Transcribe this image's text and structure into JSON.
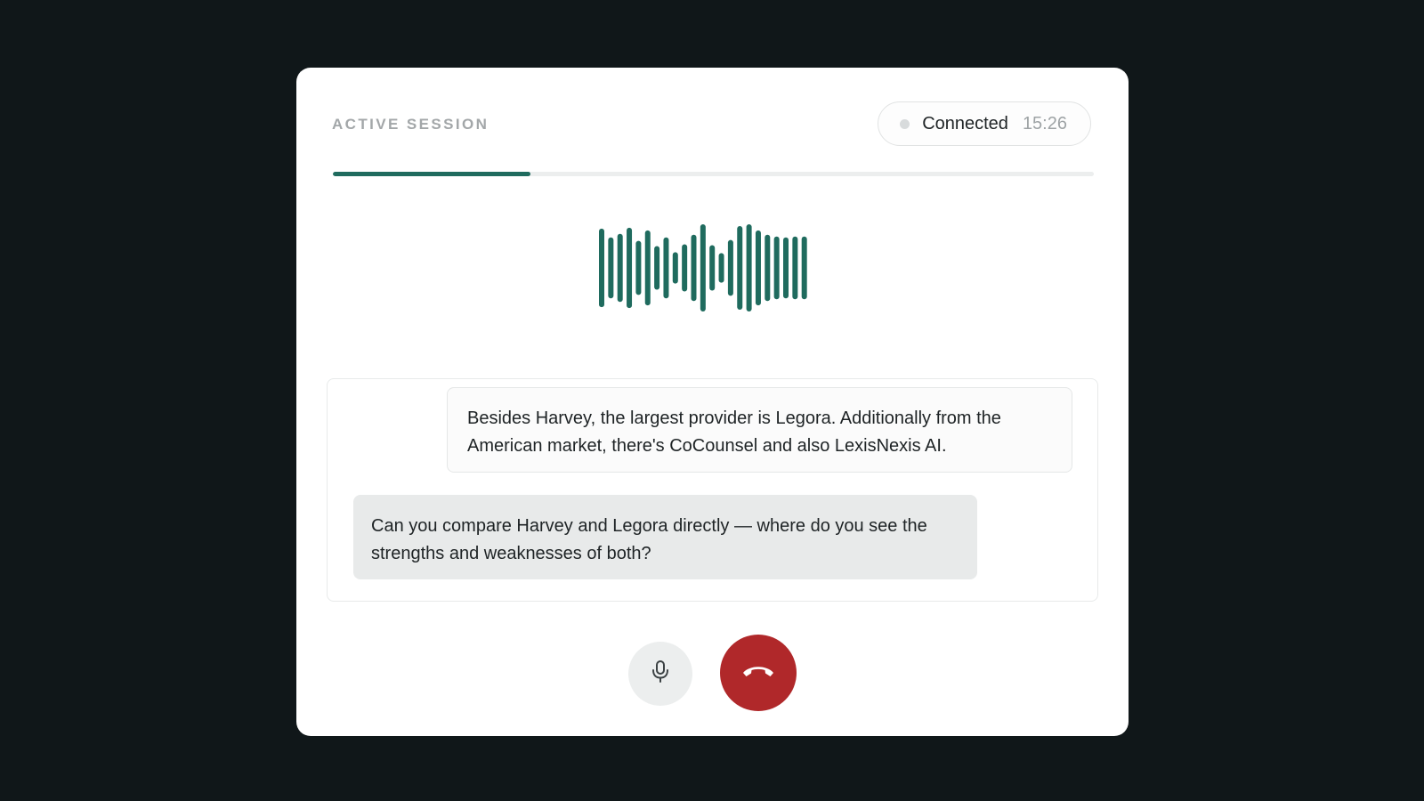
{
  "session": {
    "label": "ACTIVE SESSION",
    "status": "Connected",
    "timer": "15:26",
    "status_dot_color": "#d8dbdc"
  },
  "progress": {
    "fraction": 0.26,
    "color": "#1f6b5e"
  },
  "waveform": {
    "color": "#1f6b5e",
    "levels": [
      0.9,
      0.7,
      0.78,
      0.92,
      0.62,
      0.86,
      0.5,
      0.7,
      0.36,
      0.54,
      0.76,
      1.0,
      0.52,
      0.34,
      0.64,
      0.96,
      1.0,
      0.86,
      0.76,
      0.72,
      0.7,
      0.72,
      0.72
    ]
  },
  "transcript": {
    "assistant_message": "Besides Harvey, the largest provider is Legora. Additionally from the American market, there's CoCounsel and also LexisNexis AI.",
    "user_message": "Can you compare Harvey and Legora directly — where do you see the strengths and weaknesses of both?"
  },
  "controls": {
    "mic_icon": "microphone-icon",
    "end_call_icon": "phone-hangup-icon",
    "end_call_color": "#b0282a"
  }
}
